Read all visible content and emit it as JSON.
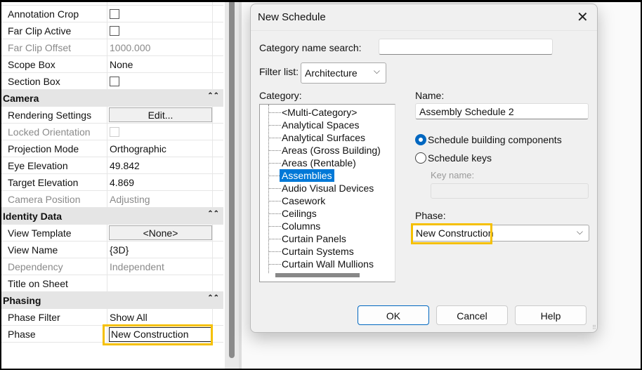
{
  "properties": {
    "rows": [
      {
        "label": "Annotation Crop",
        "type": "checkbox"
      },
      {
        "label": "Far Clip Active",
        "type": "checkbox"
      },
      {
        "label": "Far Clip Offset",
        "value": "1000.000",
        "disabled": true
      },
      {
        "label": "Scope Box",
        "value": "None"
      },
      {
        "label": "Section Box",
        "type": "checkbox"
      }
    ],
    "camera": {
      "header": "Camera",
      "rendering_settings": "Rendering Settings",
      "edit_button": "Edit...",
      "locked_orientation": "Locked Orientation",
      "projection_mode": "Projection Mode",
      "projection_value": "Orthographic",
      "eye_elevation": "Eye Elevation",
      "eye_value": "49.842",
      "target_elevation": "Target Elevation",
      "target_value": "4.869",
      "camera_position": "Camera Position",
      "camera_position_value": "Adjusting"
    },
    "identity": {
      "header": "Identity Data",
      "view_template": "View Template",
      "view_template_value": "<None>",
      "view_name": "View Name",
      "view_name_value": "{3D}",
      "dependency": "Dependency",
      "dependency_value": "Independent",
      "title_on_sheet": "Title on Sheet"
    },
    "phasing": {
      "header": "Phasing",
      "phase_filter": "Phase Filter",
      "phase_filter_value": "Show All",
      "phase": "Phase",
      "phase_value": "New Construction"
    },
    "collapse_glyph": "⌃⌃"
  },
  "dialog": {
    "title": "New Schedule",
    "close": "✕",
    "category_search_label": "Category name search:",
    "category_search_value": "",
    "filter_label": "Filter list:",
    "filter_value": "Architecture",
    "category_label": "Category:",
    "categories": [
      "<Multi-Category>",
      "Analytical Spaces",
      "Analytical Surfaces",
      "Areas (Gross Building)",
      "Areas (Rentable)",
      "Assemblies",
      "Audio Visual Devices",
      "Casework",
      "Ceilings",
      "Columns",
      "Curtain Panels",
      "Curtain Systems",
      "Curtain Wall Mullions"
    ],
    "selected_category": "Assemblies",
    "name_label": "Name:",
    "name_value": "Assembly Schedule 2",
    "radio_components": "Schedule building components",
    "radio_keys": "Schedule keys",
    "key_name_label": "Key name:",
    "phase_label": "Phase:",
    "phase_value": "New Construction",
    "ok": "OK",
    "cancel": "Cancel",
    "help": "Help",
    "chevron": "⌵"
  },
  "colors": {
    "highlight": "#f5c000",
    "accent": "#0078d7"
  }
}
